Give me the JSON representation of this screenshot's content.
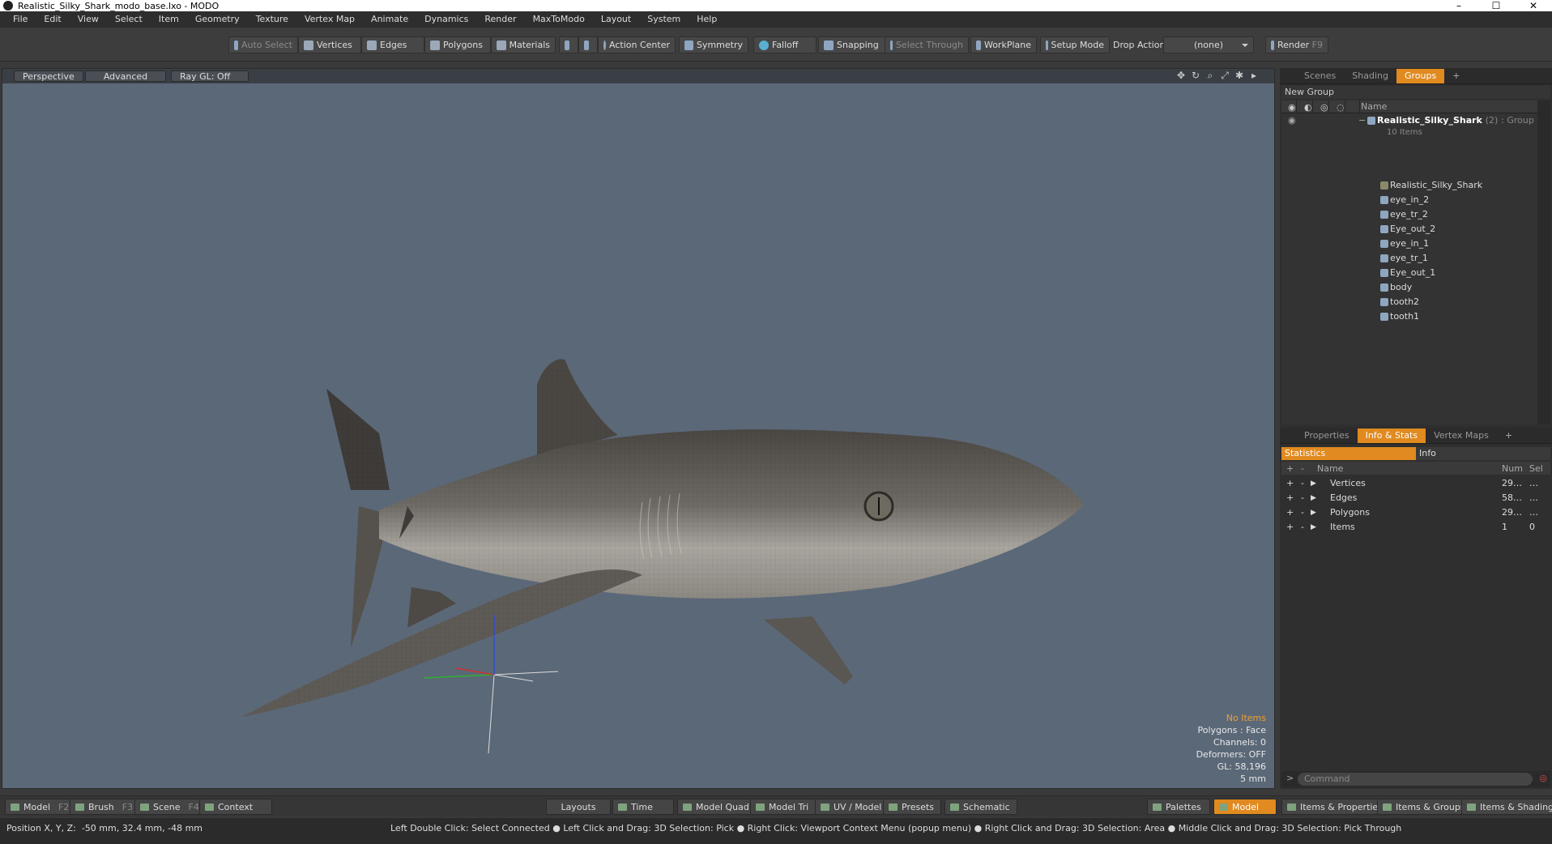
{
  "window": {
    "title": "Realistic_Silky_Shark_modo_base.lxo - MODO",
    "controls": [
      "–",
      "☐",
      "✕"
    ]
  },
  "menu": [
    "File",
    "Edit",
    "View",
    "Select",
    "Item",
    "Geometry",
    "Texture",
    "Vertex Map",
    "Animate",
    "Dynamics",
    "Render",
    "MaxToModo",
    "Layout",
    "System",
    "Help"
  ],
  "toolbar": {
    "auto_select": "Auto Select",
    "vertices": "Vertices",
    "edges": "Edges",
    "polygons": "Polygons",
    "materials": "Materials",
    "action_center": "Action Center",
    "symmetry": "Symmetry",
    "falloff": "Falloff",
    "snapping": "Snapping",
    "select_through": "Select Through",
    "workplane": "WorkPlane",
    "setup_mode": "Setup Mode",
    "drop_action_label": "Drop Action",
    "drop_action_value": "(none)",
    "render": "Render",
    "render_key": "F9"
  },
  "viewport": {
    "perspective": "Perspective",
    "advanced": "Advanced",
    "ray_gl": "Ray GL: Off",
    "info": {
      "items": "No Items",
      "polygons": "Polygons : Face",
      "channels": "Channels: 0",
      "deformers": "Deformers: OFF",
      "gl": "GL: 58,196",
      "scale": "5 mm"
    },
    "colors": {
      "background": "#5b6878",
      "shark": "#8a857e"
    }
  },
  "groups_panel": {
    "tabs": [
      "Scenes",
      "Shading",
      "Groups"
    ],
    "active_tab": "Groups",
    "new_group": "New Group",
    "name_header": "Name",
    "group": {
      "name": "Realistic_Silky_Shark",
      "count": "(2)",
      "type": ": Group",
      "sub": "10 Items"
    },
    "items": [
      "Realistic_Silky_Shark",
      "eye_in_2",
      "eye_tr_2",
      "Eye_out_2",
      "eye_in_1",
      "eye_tr_1",
      "Eye_out_1",
      "body",
      "tooth2",
      "tooth1"
    ]
  },
  "stats_panel": {
    "tabs": [
      "Properties",
      "Info & Stats",
      "Vertex Maps"
    ],
    "active_tab": "Info & Stats",
    "sub_tabs": [
      "Statistics",
      "Info"
    ],
    "columns": {
      "name": "Name",
      "num": "Num",
      "sel": "Sel"
    },
    "rows": [
      {
        "name": "Vertices",
        "num": "29…",
        "sel": "…"
      },
      {
        "name": "Edges",
        "num": "58…",
        "sel": "…"
      },
      {
        "name": "Polygons",
        "num": "29…",
        "sel": "…"
      },
      {
        "name": "Items",
        "num": "1",
        "sel": "0"
      }
    ],
    "command_placeholder": "Command"
  },
  "bottom_bar": {
    "model": "Model",
    "model_key": "F2",
    "brush": "Brush",
    "brush_key": "F3",
    "scene": "Scene",
    "scene_key": "F4",
    "context": "Context",
    "layouts": "Layouts",
    "time": "Time",
    "model_quad": "Model Quad",
    "model_tri": "Model Tri",
    "uv_model": "UV / Model",
    "presets": "Presets",
    "schematic": "Schematic",
    "palettes": "Palettes",
    "model_active": "Model",
    "items_properties": "Items & Properties",
    "items_groups": "Items & Groups",
    "items_shading": "Items & Shading"
  },
  "status": {
    "position_label": "Position X, Y, Z:",
    "position_value": "-50 mm, 32.4 mm, -48 mm",
    "hint": "Left Double Click: Select Connected ● Left Click and Drag: 3D Selection: Pick ● Right Click: Viewport Context Menu (popup menu) ● Right Click and Drag: 3D Selection: Area ● Middle Click and Drag: 3D Selection: Pick Through"
  }
}
